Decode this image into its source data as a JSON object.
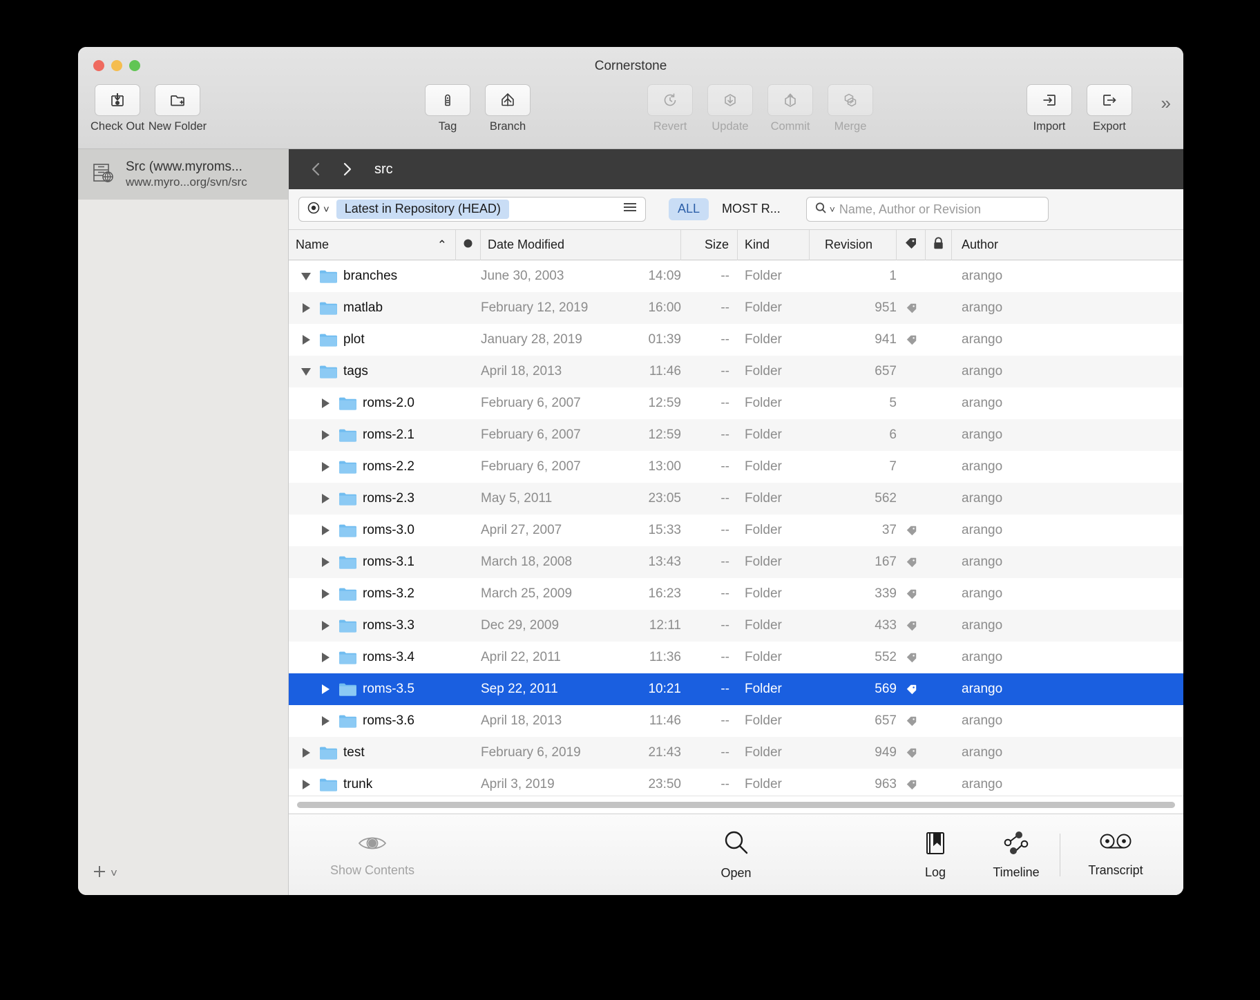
{
  "window": {
    "title": "Cornerstone",
    "traffic_lights": [
      "close",
      "minimize",
      "zoom"
    ]
  },
  "toolbar": {
    "left_items": [
      {
        "label": "Check Out",
        "icon": "check-out-icon",
        "disabled": false
      },
      {
        "label": "New Folder",
        "icon": "new-folder-icon",
        "disabled": false
      }
    ],
    "center_items": [
      {
        "label": "Tag",
        "icon": "tag-icon",
        "disabled": false
      },
      {
        "label": "Branch",
        "icon": "branch-icon",
        "disabled": false
      }
    ],
    "action_items": [
      {
        "label": "Revert",
        "icon": "revert-icon",
        "disabled": true
      },
      {
        "label": "Update",
        "icon": "update-icon",
        "disabled": true
      },
      {
        "label": "Commit",
        "icon": "commit-icon",
        "disabled": true
      },
      {
        "label": "Merge",
        "icon": "merge-icon",
        "disabled": true
      }
    ],
    "right_items": [
      {
        "label": "Import",
        "icon": "import-icon",
        "disabled": false
      },
      {
        "label": "Export",
        "icon": "export-icon",
        "disabled": false
      }
    ],
    "overflow": "»"
  },
  "sidebar": {
    "repository": {
      "name": "Src (www.myroms...",
      "url": "www.myro...org/svn/src",
      "icon": "repository-icon"
    },
    "add_button": {
      "icon": "plus-icon",
      "chevron": "˅"
    }
  },
  "pathbar": {
    "back": "‹",
    "forward": "›",
    "path": "src"
  },
  "filterbar": {
    "revision_selector": {
      "icon": "record-circle-icon",
      "chevron": "˅",
      "value": "Latest in Repository (HEAD)",
      "menu_icon": "hamburger-icon"
    },
    "segments": [
      {
        "label": "ALL",
        "active": true
      },
      {
        "label": "MOST R...",
        "active": false
      }
    ],
    "search": {
      "icon": "search-icon",
      "chevron": "˅",
      "placeholder": "Name, Author or Revision",
      "value": ""
    }
  },
  "table": {
    "columns": [
      {
        "key": "name",
        "label": "Name",
        "sort": "asc",
        "sort_glyph": "⌃"
      },
      {
        "key": "status",
        "label": "",
        "icon": "status-dot-icon"
      },
      {
        "key": "date",
        "label": "Date Modified"
      },
      {
        "key": "size",
        "label": "Size"
      },
      {
        "key": "kind",
        "label": "Kind"
      },
      {
        "key": "revision",
        "label": "Revision"
      },
      {
        "key": "tag",
        "label": "",
        "icon": "tag-column-icon"
      },
      {
        "key": "lock",
        "label": "",
        "icon": "lock-column-icon"
      },
      {
        "key": "author",
        "label": "Author"
      }
    ],
    "rows": [
      {
        "indent": 0,
        "twisty": "down",
        "name": "branches",
        "date": "June 30, 2003",
        "time": "14:09",
        "size": "--",
        "kind": "Folder",
        "revision": "1",
        "tag": false,
        "author": "arango",
        "selected": false
      },
      {
        "indent": 0,
        "twisty": "right",
        "name": "matlab",
        "date": "February 12, 2019",
        "time": "16:00",
        "size": "--",
        "kind": "Folder",
        "revision": "951",
        "tag": true,
        "author": "arango",
        "selected": false
      },
      {
        "indent": 0,
        "twisty": "right",
        "name": "plot",
        "date": "January 28, 2019",
        "time": "01:39",
        "size": "--",
        "kind": "Folder",
        "revision": "941",
        "tag": true,
        "author": "arango",
        "selected": false
      },
      {
        "indent": 0,
        "twisty": "down",
        "name": "tags",
        "date": "April 18, 2013",
        "time": "11:46",
        "size": "--",
        "kind": "Folder",
        "revision": "657",
        "tag": false,
        "author": "arango",
        "selected": false
      },
      {
        "indent": 1,
        "twisty": "right",
        "name": "roms-2.0",
        "date": "February 6, 2007",
        "time": "12:59",
        "size": "--",
        "kind": "Folder",
        "revision": "5",
        "tag": false,
        "author": "arango",
        "selected": false
      },
      {
        "indent": 1,
        "twisty": "right",
        "name": "roms-2.1",
        "date": "February 6, 2007",
        "time": "12:59",
        "size": "--",
        "kind": "Folder",
        "revision": "6",
        "tag": false,
        "author": "arango",
        "selected": false
      },
      {
        "indent": 1,
        "twisty": "right",
        "name": "roms-2.2",
        "date": "February 6, 2007",
        "time": "13:00",
        "size": "--",
        "kind": "Folder",
        "revision": "7",
        "tag": false,
        "author": "arango",
        "selected": false
      },
      {
        "indent": 1,
        "twisty": "right",
        "name": "roms-2.3",
        "date": "May 5, 2011",
        "time": "23:05",
        "size": "--",
        "kind": "Folder",
        "revision": "562",
        "tag": false,
        "author": "arango",
        "selected": false
      },
      {
        "indent": 1,
        "twisty": "right",
        "name": "roms-3.0",
        "date": "April 27, 2007",
        "time": "15:33",
        "size": "--",
        "kind": "Folder",
        "revision": "37",
        "tag": true,
        "author": "arango",
        "selected": false
      },
      {
        "indent": 1,
        "twisty": "right",
        "name": "roms-3.1",
        "date": "March 18, 2008",
        "time": "13:43",
        "size": "--",
        "kind": "Folder",
        "revision": "167",
        "tag": true,
        "author": "arango",
        "selected": false
      },
      {
        "indent": 1,
        "twisty": "right",
        "name": "roms-3.2",
        "date": "March 25, 2009",
        "time": "16:23",
        "size": "--",
        "kind": "Folder",
        "revision": "339",
        "tag": true,
        "author": "arango",
        "selected": false
      },
      {
        "indent": 1,
        "twisty": "right",
        "name": "roms-3.3",
        "date": "Dec 29, 2009",
        "time": "12:11",
        "size": "--",
        "kind": "Folder",
        "revision": "433",
        "tag": true,
        "author": "arango",
        "selected": false
      },
      {
        "indent": 1,
        "twisty": "right",
        "name": "roms-3.4",
        "date": "April 22, 2011",
        "time": "11:36",
        "size": "--",
        "kind": "Folder",
        "revision": "552",
        "tag": true,
        "author": "arango",
        "selected": false
      },
      {
        "indent": 1,
        "twisty": "right",
        "name": "roms-3.5",
        "date": "Sep 22, 2011",
        "time": "10:21",
        "size": "--",
        "kind": "Folder",
        "revision": "569",
        "tag": true,
        "author": "arango",
        "selected": true
      },
      {
        "indent": 1,
        "twisty": "right",
        "name": "roms-3.6",
        "date": "April 18, 2013",
        "time": "11:46",
        "size": "--",
        "kind": "Folder",
        "revision": "657",
        "tag": true,
        "author": "arango",
        "selected": false
      },
      {
        "indent": 0,
        "twisty": "right",
        "name": "test",
        "date": "February 6, 2019",
        "time": "21:43",
        "size": "--",
        "kind": "Folder",
        "revision": "949",
        "tag": true,
        "author": "arango",
        "selected": false
      },
      {
        "indent": 0,
        "twisty": "right",
        "name": "trunk",
        "date": "April 3, 2019",
        "time": "23:50",
        "size": "--",
        "kind": "Folder",
        "revision": "963",
        "tag": true,
        "author": "arango",
        "selected": false
      }
    ]
  },
  "bottombar": {
    "items": [
      {
        "label": "Show Contents",
        "icon": "eye-icon",
        "disabled": true
      },
      {
        "label": "Open",
        "icon": "magnifier-icon",
        "disabled": false
      },
      {
        "label": "Log",
        "icon": "book-bookmark-icon",
        "disabled": false
      },
      {
        "label": "Timeline",
        "icon": "timeline-nodes-icon",
        "disabled": false
      },
      {
        "label": "Transcript",
        "icon": "reels-icon",
        "disabled": false
      }
    ]
  },
  "colors": {
    "selection_blue": "#1a5fe0",
    "pill_blue": "#c9ddf5",
    "pathbar_dark": "#3b3b3b",
    "folder_blue": "#6dbbf0"
  }
}
